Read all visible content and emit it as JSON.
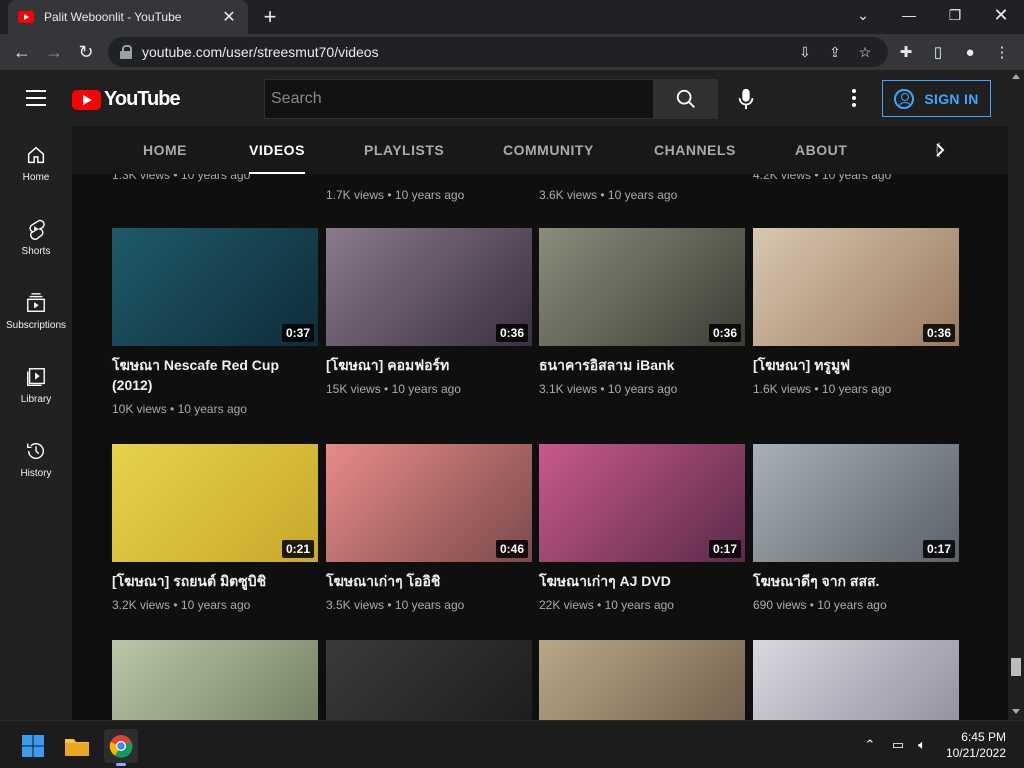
{
  "browser": {
    "tab_title": "Palit Weboonlit - YouTube",
    "url": "youtube.com/user/streesmut70/videos"
  },
  "youtube": {
    "logo_text": "YouTube",
    "search_placeholder": "Search",
    "sign_in": "SIGN IN",
    "sidebar": [
      {
        "label": "Home",
        "icon": "home-icon"
      },
      {
        "label": "Shorts",
        "icon": "shorts-icon"
      },
      {
        "label": "Subscriptions",
        "icon": "subscriptions-icon"
      },
      {
        "label": "Library",
        "icon": "library-icon"
      },
      {
        "label": "History",
        "icon": "history-icon"
      }
    ],
    "tabs": [
      "HOME",
      "VIDEOS",
      "PLAYLISTS",
      "COMMUNITY",
      "CHANNELS",
      "ABOUT"
    ],
    "active_tab": "VIDEOS",
    "partial_top_row": [
      "1.3K views • 10 years ago",
      "1.7K views • 10 years ago",
      "3.6K views • 10 years ago",
      "4.2K views • 10 years ago"
    ],
    "videos": [
      {
        "title": "โฆษณา Nescafe Red Cup (2012)",
        "views": "10K views",
        "age": "10 years ago",
        "duration": "0:37",
        "c1": "#1e5a6a",
        "c2": "#0f2c38"
      },
      {
        "title": "[โฆษณา] คอมฟอร์ท",
        "views": "15K views",
        "age": "10 years ago",
        "duration": "0:36",
        "c1": "#8a7a8c",
        "c2": "#3a2f40"
      },
      {
        "title": "ธนาคารอิสลาม iBank",
        "views": "3.1K views",
        "age": "10 years ago",
        "duration": "0:36",
        "c1": "#8c8c7c",
        "c2": "#3c3c34"
      },
      {
        "title": "[โฆษณา] ทรูมูฟ",
        "views": "1.6K views",
        "age": "10 years ago",
        "duration": "0:36",
        "c1": "#d8c8b0",
        "c2": "#9a7a60"
      },
      {
        "title": "[โฆษณา] รถยนต์ มิตซูบิชิ",
        "views": "3.2K views",
        "age": "10 years ago",
        "duration": "0:21",
        "c1": "#e8d24a",
        "c2": "#c8a82a"
      },
      {
        "title": "โฆษณาเก่าๆ โออิชิ",
        "views": "3.5K views",
        "age": "10 years ago",
        "duration": "0:46",
        "c1": "#e88a8a",
        "c2": "#7a4a4a"
      },
      {
        "title": "โฆษณาเก่าๆ AJ DVD",
        "views": "22K views",
        "age": "10 years ago",
        "duration": "0:17",
        "c1": "#c85a8a",
        "c2": "#5a2a4a"
      },
      {
        "title": "โฆษณาดีๆ จาก สสส.",
        "views": "690 views",
        "age": "10 years ago",
        "duration": "0:17",
        "c1": "#a8b0b8",
        "c2": "#5a6068"
      },
      {
        "title": "",
        "views": "",
        "age": "",
        "duration": "",
        "c1": "#b8c8a8",
        "c2": "#6a7a5a"
      },
      {
        "title": "",
        "views": "",
        "age": "",
        "duration": "",
        "c1": "#3a3a3a",
        "c2": "#1a1a1a"
      },
      {
        "title": "",
        "views": "",
        "age": "",
        "duration": "",
        "c1": "#b8a888",
        "c2": "#6a5a48"
      },
      {
        "title": "",
        "views": "",
        "age": "",
        "duration": "",
        "c1": "#d8d8e0",
        "c2": "#8a8a9a"
      }
    ]
  },
  "taskbar": {
    "time": "6:45 PM",
    "date": "10/21/2022"
  }
}
